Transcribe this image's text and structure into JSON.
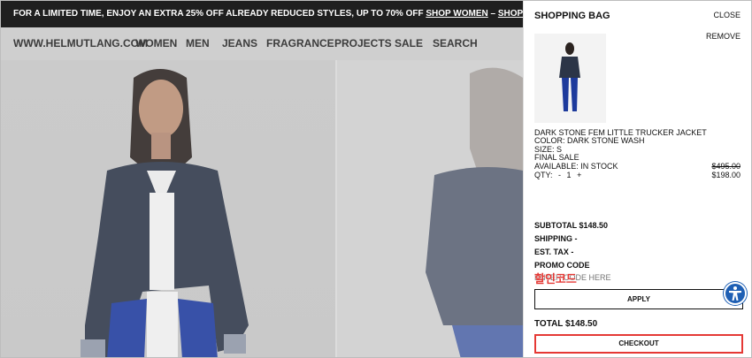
{
  "banner": {
    "text": "FOR A LIMITED TIME, ENJOY AN EXTRA 25% OFF ALREADY REDUCED STYLES, UP TO 70% OFF ",
    "link_women": "SHOP WOMEN",
    "separator": " – ",
    "link_men": "SHOP MEN"
  },
  "nav": {
    "site": "WWW.HELMUTLANG.COM",
    "items": [
      "WOMEN",
      "MEN",
      "JEANS",
      "FRAGRANCE",
      "PROJECTS",
      "SALE",
      "SEARCH"
    ]
  },
  "bag": {
    "title": "SHOPPING BAG",
    "close_label": "CLOSE",
    "remove_label": "REMOVE",
    "product": {
      "name": "DARK STONE FEM LITTLE TRUCKER JACKET",
      "color": "COLOR: DARK STONE WASH",
      "size": "SIZE: S",
      "final_sale": "FINAL SALE",
      "availability": "AVAILABLE: IN STOCK",
      "qty_label": "QTY:",
      "qty_minus": "-",
      "qty_value": "1",
      "qty_plus": "+",
      "price_original": "$495.00",
      "price_sale": "$198.00"
    },
    "subtotal": "SUBTOTAL $148.50",
    "shipping": "SHIPPING -",
    "est_tax": "EST. TAX -",
    "promo_code_label": "PROMO CODE",
    "promo_input_placeholder": "ENTER CODE HERE",
    "promo_stamp": "할인코드",
    "apply_label": "APPLY",
    "total": "TOTAL $148.50",
    "checkout_label": "CHECKOUT"
  },
  "colors": {
    "banner_bg": "#000000",
    "accent_red": "#e53935",
    "a11y_blue": "#1e5fb4",
    "denim": "#1d3a9c"
  },
  "icons": {
    "accessibility": "accessibility-icon"
  }
}
